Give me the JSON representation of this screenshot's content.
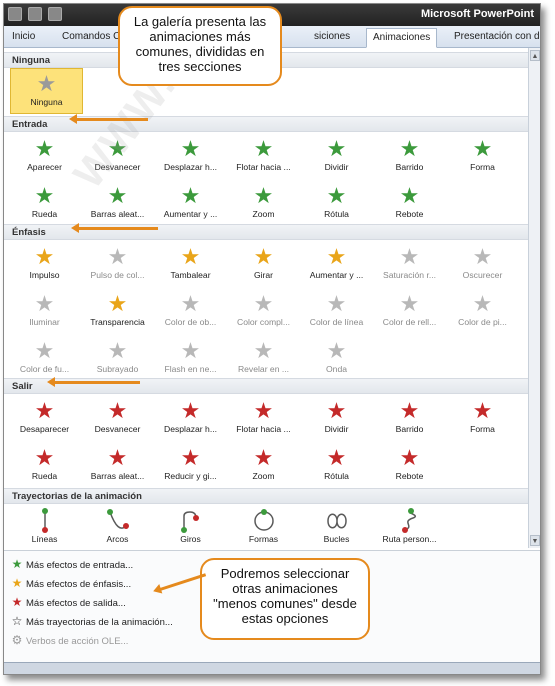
{
  "app_title": "Microsoft PowerPoint",
  "tabs": [
    {
      "label": "Inicio"
    },
    {
      "label": "Comandos C"
    },
    {
      "label": "siciones"
    },
    {
      "label": "Animaciones"
    },
    {
      "label": "Presentación con d"
    }
  ],
  "sections": {
    "ninguna": "Ninguna",
    "entrada": "Entrada",
    "enfasis": "Énfasis",
    "salir": "Salir",
    "trayectorias": "Trayectorias de la animación"
  },
  "ninguna_item": "Ninguna",
  "entrada_items": [
    "Aparecer",
    "Desvanecer",
    "Desplazar h...",
    "Flotar hacia ...",
    "Dividir",
    "Barrido",
    "Forma",
    "Rueda",
    "Barras aleat...",
    "Aumentar y ...",
    "Zoom",
    "Rótula",
    "Rebote"
  ],
  "enfasis_items": [
    "Impulso",
    "Pulso de col...",
    "Tambalear",
    "Girar",
    "Aumentar y ...",
    "Saturación r...",
    "Oscurecer",
    "Iluminar",
    "Transparencia",
    "Color de ob...",
    "Color compl...",
    "Color de línea",
    "Color de rell...",
    "Color de pi...",
    "Color de fu...",
    "Subrayado",
    "Flash en ne...",
    "Revelar en ...",
    "Onda"
  ],
  "salir_items": [
    "Desaparecer",
    "Desvanecer",
    "Desplazar h...",
    "Flotar hacia ...",
    "Dividir",
    "Barrido",
    "Forma",
    "Rueda",
    "Barras aleat...",
    "Reducir y gi...",
    "Zoom",
    "Rótula",
    "Rebote"
  ],
  "trayectorias_items": [
    "Líneas",
    "Arcos",
    "Giros",
    "Formas",
    "Bucles",
    "Ruta person..."
  ],
  "menu_items": [
    {
      "label": "Más efectos de entrada..."
    },
    {
      "label": "Más efectos de énfasis..."
    },
    {
      "label": "Más efectos de salida..."
    },
    {
      "label": "Más trayectorias de la animación..."
    },
    {
      "label": "Verbos de acción OLE..."
    }
  ],
  "callouts": {
    "top": "La galería presenta las animaciones más comunes, divididas en tres secciones",
    "bottom": "Podremos seleccionar otras animaciones \"menos comunes\" desde estas opciones"
  },
  "watermark": "WWW.INFORMATICAEDIA.COM",
  "colors": {
    "callout_border": "#e58a1d",
    "entrada": "#3c9a3c",
    "enfasis": "#e9a51a",
    "salir": "#c42a2a",
    "disabled": "#9a9a9a"
  }
}
